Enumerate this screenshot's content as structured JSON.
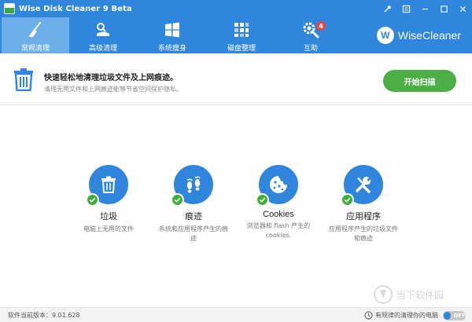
{
  "window": {
    "title": "Wise Disk Cleaner 9 Beta"
  },
  "colors": {
    "primary": "#2f86dc",
    "active_tab": "#6aaeea",
    "accent_green": "#4caf45",
    "badge_red": "#e84545"
  },
  "toolbar": {
    "tabs": [
      {
        "label": "常规清理",
        "icon": "broom-icon",
        "active": true
      },
      {
        "label": "高级清理",
        "icon": "advanced-clean-icon",
        "active": false
      },
      {
        "label": "系统瘦身",
        "icon": "windows-icon",
        "active": false
      },
      {
        "label": "磁盘整理",
        "icon": "defrag-icon",
        "active": false
      },
      {
        "label": "互助",
        "icon": "gear-wrench-icon",
        "active": false,
        "badge": "4"
      }
    ],
    "brand": {
      "logo_letter": "W",
      "name": "WiseCleaner"
    }
  },
  "banner": {
    "title": "快速轻松地清理垃圾文件及上网痕迹。",
    "description": "清理无用文件和上网痕迹能够节省空间保护隐私。",
    "start_button": "开始扫描"
  },
  "items": [
    {
      "title": "垃圾",
      "description": "电脑上无用的文件",
      "icon": "trash-icon",
      "checked": true
    },
    {
      "title": "痕迹",
      "description": "系统和应用程序产生的痕迹",
      "icon": "footprints-icon",
      "checked": true
    },
    {
      "title": "Cookies",
      "description": "浏览器和 flash 产生的 cookies.",
      "icon": "cookie-icon",
      "checked": true
    },
    {
      "title": "应用程序",
      "description": "应用程序产生的垃圾文件和痕迹",
      "icon": "tools-icon",
      "checked": true
    }
  ],
  "status": {
    "version": "软件当前版本：9.01.628",
    "schedule_text": "有规律的清理你的电脑",
    "toggle_label": "OFF"
  },
  "watermark": {
    "text": "当下软件园"
  }
}
